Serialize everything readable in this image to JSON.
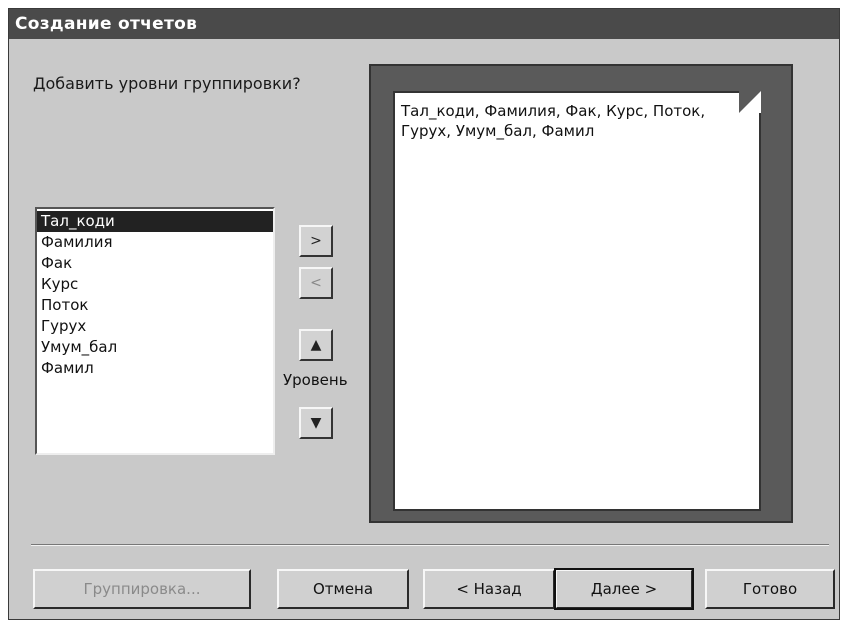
{
  "window": {
    "title": "Создание отчетов"
  },
  "prompt": {
    "text": "Добавить уровни группировки?"
  },
  "fields": {
    "items": [
      {
        "label": "Тал_коди",
        "selected": true
      },
      {
        "label": "Фамилия",
        "selected": false
      },
      {
        "label": "Фак",
        "selected": false
      },
      {
        "label": "Курс",
        "selected": false
      },
      {
        "label": "Поток",
        "selected": false
      },
      {
        "label": "Гурух",
        "selected": false
      },
      {
        "label": "Умум_бал",
        "selected": false
      },
      {
        "label": "Фамил",
        "selected": false
      }
    ]
  },
  "controls": {
    "add": ">",
    "remove": "<",
    "level_up": "▲",
    "level_down": "▼",
    "level_label": "Уровень"
  },
  "preview": {
    "text": "Тал_коди, Фамилия, Фак, Курс, Поток, Гурух, Умум_бал, Фамил"
  },
  "buttons": {
    "grouping": "Группировка...",
    "cancel": "Отмена",
    "back": "< Назад",
    "next": "Далее >",
    "finish": "Готово"
  },
  "colors": {
    "titlebar": "#4a4a4a",
    "dialog_bg": "#c9c9c9",
    "selection": "#222222",
    "preview_frame": "#5a5a5a"
  }
}
